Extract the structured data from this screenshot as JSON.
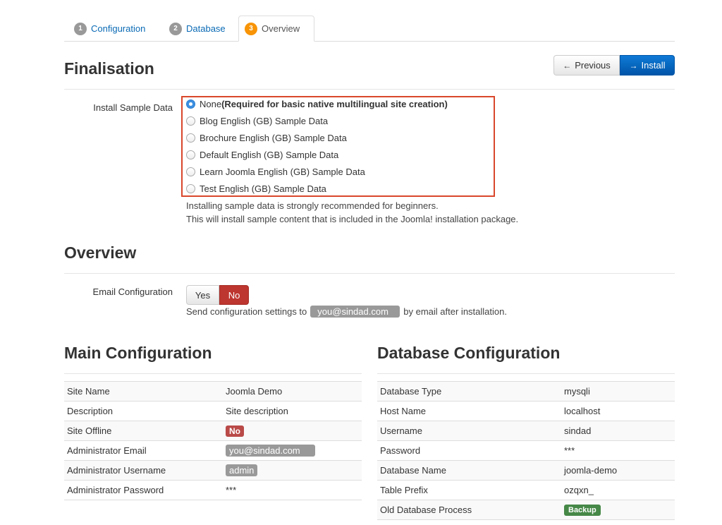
{
  "tabs": [
    {
      "num": "1",
      "label": "Configuration"
    },
    {
      "num": "2",
      "label": "Database"
    },
    {
      "num": "3",
      "label": "Overview"
    }
  ],
  "finalisation": {
    "title": "Finalisation",
    "previous_label": "Previous",
    "install_label": "Install",
    "sample_label": "Install Sample Data",
    "options": [
      {
        "label": "None ",
        "bold": "(Required for basic native multilingual site creation)",
        "checked": true
      },
      {
        "label": "Blog English (GB) Sample Data",
        "bold": "",
        "checked": false
      },
      {
        "label": "Brochure English (GB) Sample Data",
        "bold": "",
        "checked": false
      },
      {
        "label": "Default English (GB) Sample Data",
        "bold": "",
        "checked": false
      },
      {
        "label": "Learn Joomla English (GB) Sample Data",
        "bold": "",
        "checked": false
      },
      {
        "label": "Test English (GB) Sample Data",
        "bold": "",
        "checked": false
      }
    ],
    "help_line1": "Installing sample data is strongly recommended for beginners.",
    "help_line2": "This will install sample content that is included in the Joomla! installation package."
  },
  "overview": {
    "title": "Overview",
    "email_label": "Email Configuration",
    "yes_label": "Yes",
    "no_label": "No",
    "send_prefix": "Send configuration settings to",
    "email": "you@sindad.com",
    "send_suffix": "by email after installation."
  },
  "main_config": {
    "title": "Main Configuration",
    "rows": {
      "site_name": {
        "key": "Site Name",
        "value": "Joomla Demo"
      },
      "description": {
        "key": "Description",
        "value": "Site description"
      },
      "site_offline": {
        "key": "Site Offline",
        "value": "No"
      },
      "admin_email": {
        "key": "Administrator Email",
        "value": "you@sindad.com"
      },
      "admin_username": {
        "key": "Administrator Username",
        "value": "admin"
      },
      "admin_password": {
        "key": "Administrator Password",
        "value": "***"
      }
    }
  },
  "db_config": {
    "title": "Database Configuration",
    "rows": {
      "db_type": {
        "key": "Database Type",
        "value": "mysqli"
      },
      "host": {
        "key": "Host Name",
        "value": "localhost"
      },
      "username": {
        "key": "Username",
        "value": "sindad"
      },
      "password": {
        "key": "Password",
        "value": "***"
      },
      "db_name": {
        "key": "Database Name",
        "value": "joomla-demo"
      },
      "prefix": {
        "key": "Table Prefix",
        "value": "ozqxn_"
      },
      "old_process": {
        "key": "Old Database Process",
        "value": "Backup"
      }
    }
  },
  "colors": {
    "link": "#0a6ab5",
    "active_step": "#f89406",
    "install_button": "#0055a8",
    "no_button": "#bd362f",
    "highlight_box": "#d9472b",
    "badge_red": "#b94a48",
    "badge_green": "#468847"
  }
}
